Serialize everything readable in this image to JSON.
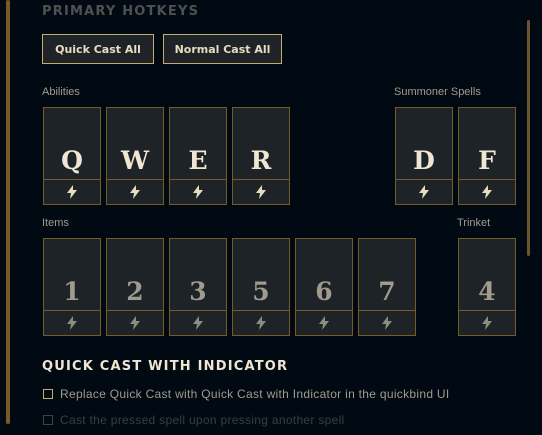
{
  "section_cut_title": "PRIMARY HOTKEYS",
  "buttons": {
    "quick_cast_all": "Quick Cast All",
    "normal_cast_all": "Normal Cast All"
  },
  "labels": {
    "abilities": "Abilities",
    "summoner_spells": "Summoner Spells",
    "items": "Items",
    "trinket": "Trinket"
  },
  "abilities": [
    "Q",
    "W",
    "E",
    "R"
  ],
  "summoner_spells": [
    "D",
    "F"
  ],
  "items": [
    "1",
    "2",
    "3",
    "5",
    "6",
    "7"
  ],
  "trinket": "4",
  "quick_cast_indicator": {
    "title": "QUICK CAST WITH INDICATOR",
    "options": [
      "Replace Quick Cast with Quick Cast with Indicator in the quickbind UI",
      "Cast the pressed spell upon pressing another spell"
    ]
  },
  "colors": {
    "gold": "#c8aa6e",
    "dark_gold": "#785a28",
    "background": "#010a13",
    "key_fill": "#1e2328"
  },
  "icons": {
    "quick_cast": "lightning-icon"
  }
}
